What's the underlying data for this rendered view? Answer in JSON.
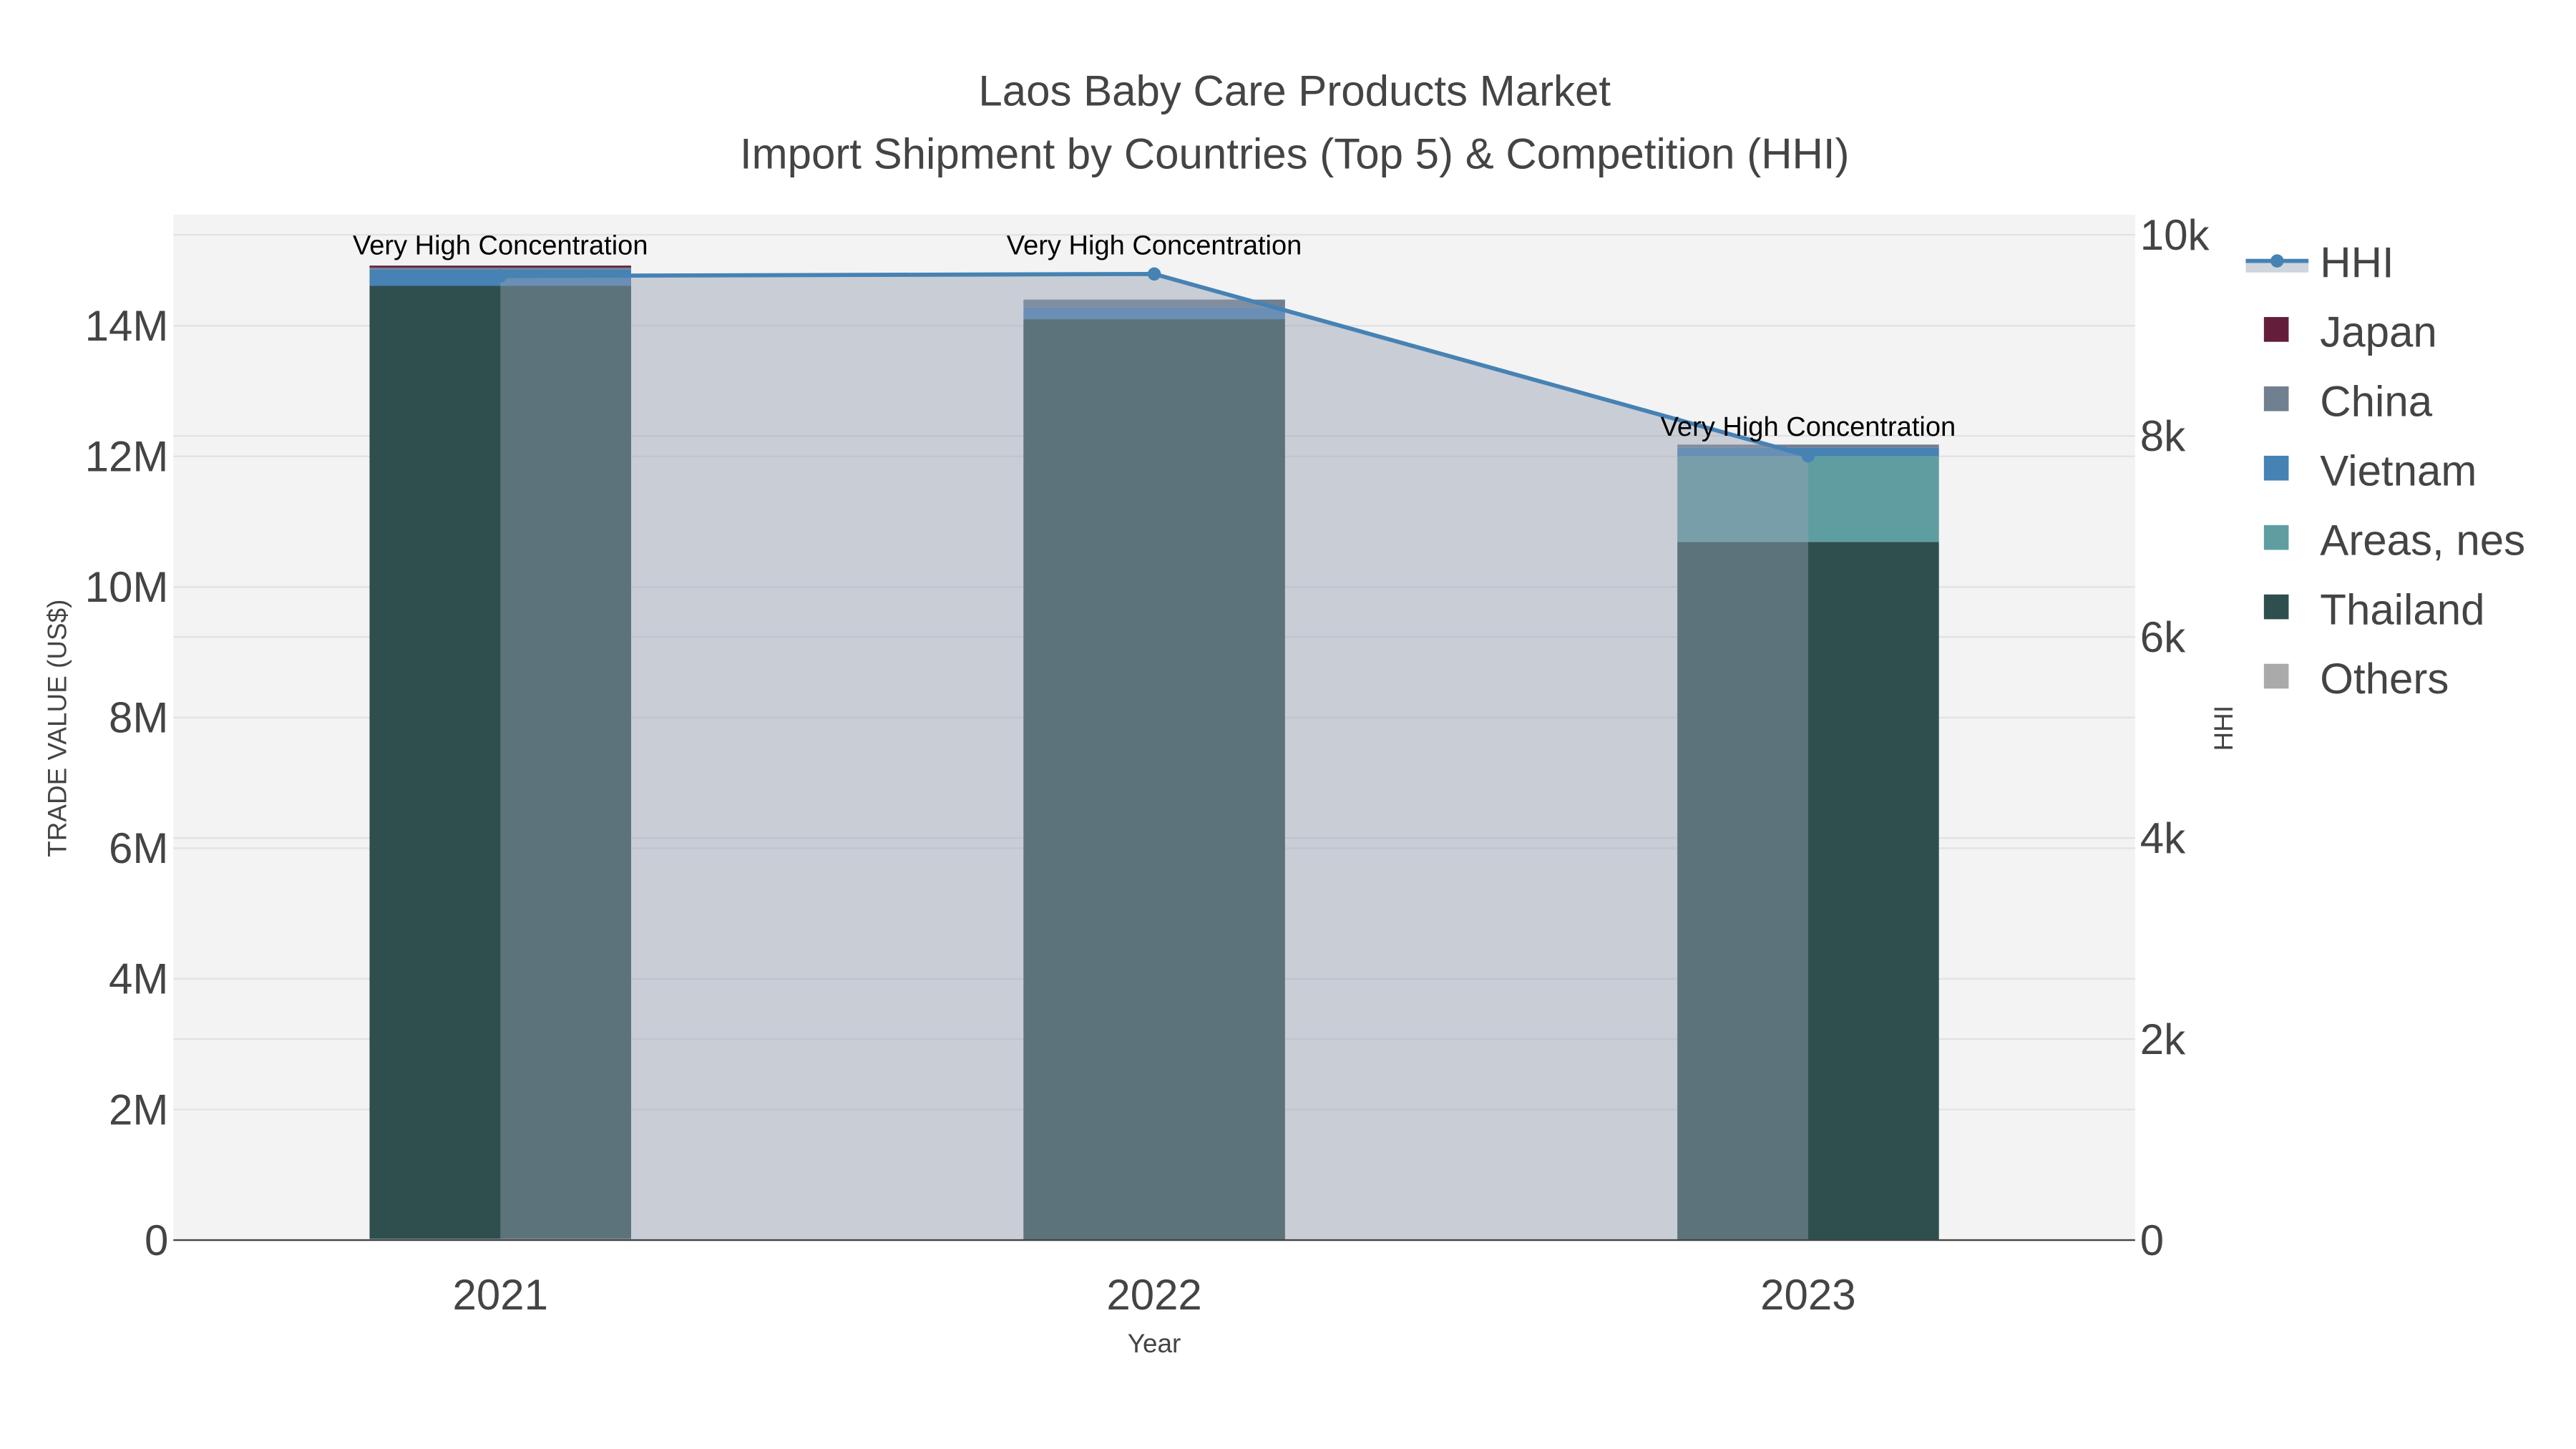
{
  "chart_data": {
    "type": "bar",
    "title": "Laos Baby Care Products Market",
    "subtitle": "Import Shipment by Countries (Top 5) & Competition (HHI)",
    "xlabel": "Year",
    "ylabel": "TRADE VALUE (US$)",
    "y2label": "HHI",
    "categories": [
      "2021",
      "2022",
      "2023"
    ],
    "ylim": [
      0,
      15700000
    ],
    "y2lim": [
      0,
      10200
    ],
    "yticks": [
      0,
      2000000,
      4000000,
      6000000,
      8000000,
      10000000,
      12000000,
      14000000
    ],
    "ytick_labels": [
      "0",
      "2M",
      "4M",
      "6M",
      "8M",
      "10M",
      "12M",
      "14M"
    ],
    "y2ticks": [
      0,
      2000,
      4000,
      6000,
      8000,
      10000
    ],
    "y2tick_labels": [
      "0",
      "2k",
      "4k",
      "6k",
      "8k",
      "10k"
    ],
    "grid": true,
    "legend_position": "right",
    "series": [
      {
        "name": "Others",
        "color": "#aaaaaa",
        "values": [
          20000,
          0,
          0
        ]
      },
      {
        "name": "Thailand",
        "color": "#2f4f4f",
        "values": [
          14590000,
          14100000,
          10690000
        ]
      },
      {
        "name": "Areas, nes",
        "color": "#5f9ea0",
        "values": [
          0,
          0,
          1310000
        ]
      },
      {
        "name": "Vietnam",
        "color": "#4682b4",
        "values": [
          250000,
          180000,
          130000
        ]
      },
      {
        "name": "China",
        "color": "#708090",
        "values": [
          30000,
          120000,
          50000
        ]
      },
      {
        "name": "Japan",
        "color": "#641e3c",
        "values": [
          30000,
          0,
          0
        ]
      }
    ],
    "legend_order": [
      "HHI",
      "Japan",
      "China",
      "Vietnam",
      "Areas, nes",
      "Thailand",
      "Others"
    ],
    "hhi": {
      "name": "HHI",
      "color": "#4682b4",
      "fill": "rgba(150,160,180,0.45)",
      "values": [
        9590,
        9610,
        7800
      ]
    },
    "annotations": [
      "Very High Concentration",
      "Very High Concentration",
      "Very High Concentration"
    ]
  }
}
